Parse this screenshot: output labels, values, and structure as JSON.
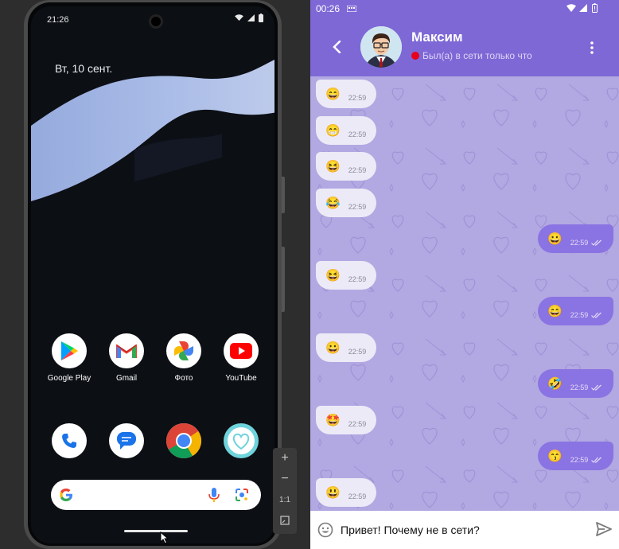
{
  "android": {
    "time": "21:26",
    "date": "Вт, 10 сент.",
    "apps_row1": [
      {
        "label": "Google Play",
        "icon": "google-play-icon"
      },
      {
        "label": "Gmail",
        "icon": "gmail-icon"
      },
      {
        "label": "Фото",
        "icon": "photos-icon"
      },
      {
        "label": "YouTube",
        "icon": "youtube-icon"
      }
    ],
    "dock": [
      {
        "icon": "phone-icon"
      },
      {
        "icon": "messages-icon"
      },
      {
        "icon": "chrome-icon"
      },
      {
        "icon": "heart-app-icon"
      }
    ]
  },
  "emulator_controls": {
    "zoom_in": "+",
    "zoom_out": "−",
    "ratio": "1:1"
  },
  "telegram": {
    "status_time": "00:26",
    "contact_name": "Максим",
    "contact_status": "Был(а) в сети только что",
    "messages": [
      {
        "dir": "in",
        "emoji": "😄",
        "time": "22:59"
      },
      {
        "dir": "in",
        "emoji": "😁",
        "time": "22:59"
      },
      {
        "dir": "in",
        "emoji": "😆",
        "time": "22:59"
      },
      {
        "dir": "in",
        "emoji": "😂",
        "time": "22:59"
      },
      {
        "dir": "out",
        "emoji": "😀",
        "time": "22:59"
      },
      {
        "dir": "in",
        "emoji": "😆",
        "time": "22:59"
      },
      {
        "dir": "out",
        "emoji": "😄",
        "time": "22:59"
      },
      {
        "dir": "in",
        "emoji": "😀",
        "time": "22:59"
      },
      {
        "dir": "out",
        "emoji": "🤣",
        "time": "22:59"
      },
      {
        "dir": "in",
        "emoji": "🤩",
        "time": "22:59"
      },
      {
        "dir": "out",
        "emoji": "😙",
        "time": "22:59"
      },
      {
        "dir": "in",
        "emoji": "😃",
        "time": "22:59"
      }
    ],
    "input_text": "Привет! Почему не в сети?"
  },
  "colors": {
    "accent": "#7e68d6",
    "chat_bg": "#b2a8e2",
    "out_bubble": "#8a73e2",
    "in_bubble": "#eceaf6",
    "online_dot": "#e8001c"
  }
}
